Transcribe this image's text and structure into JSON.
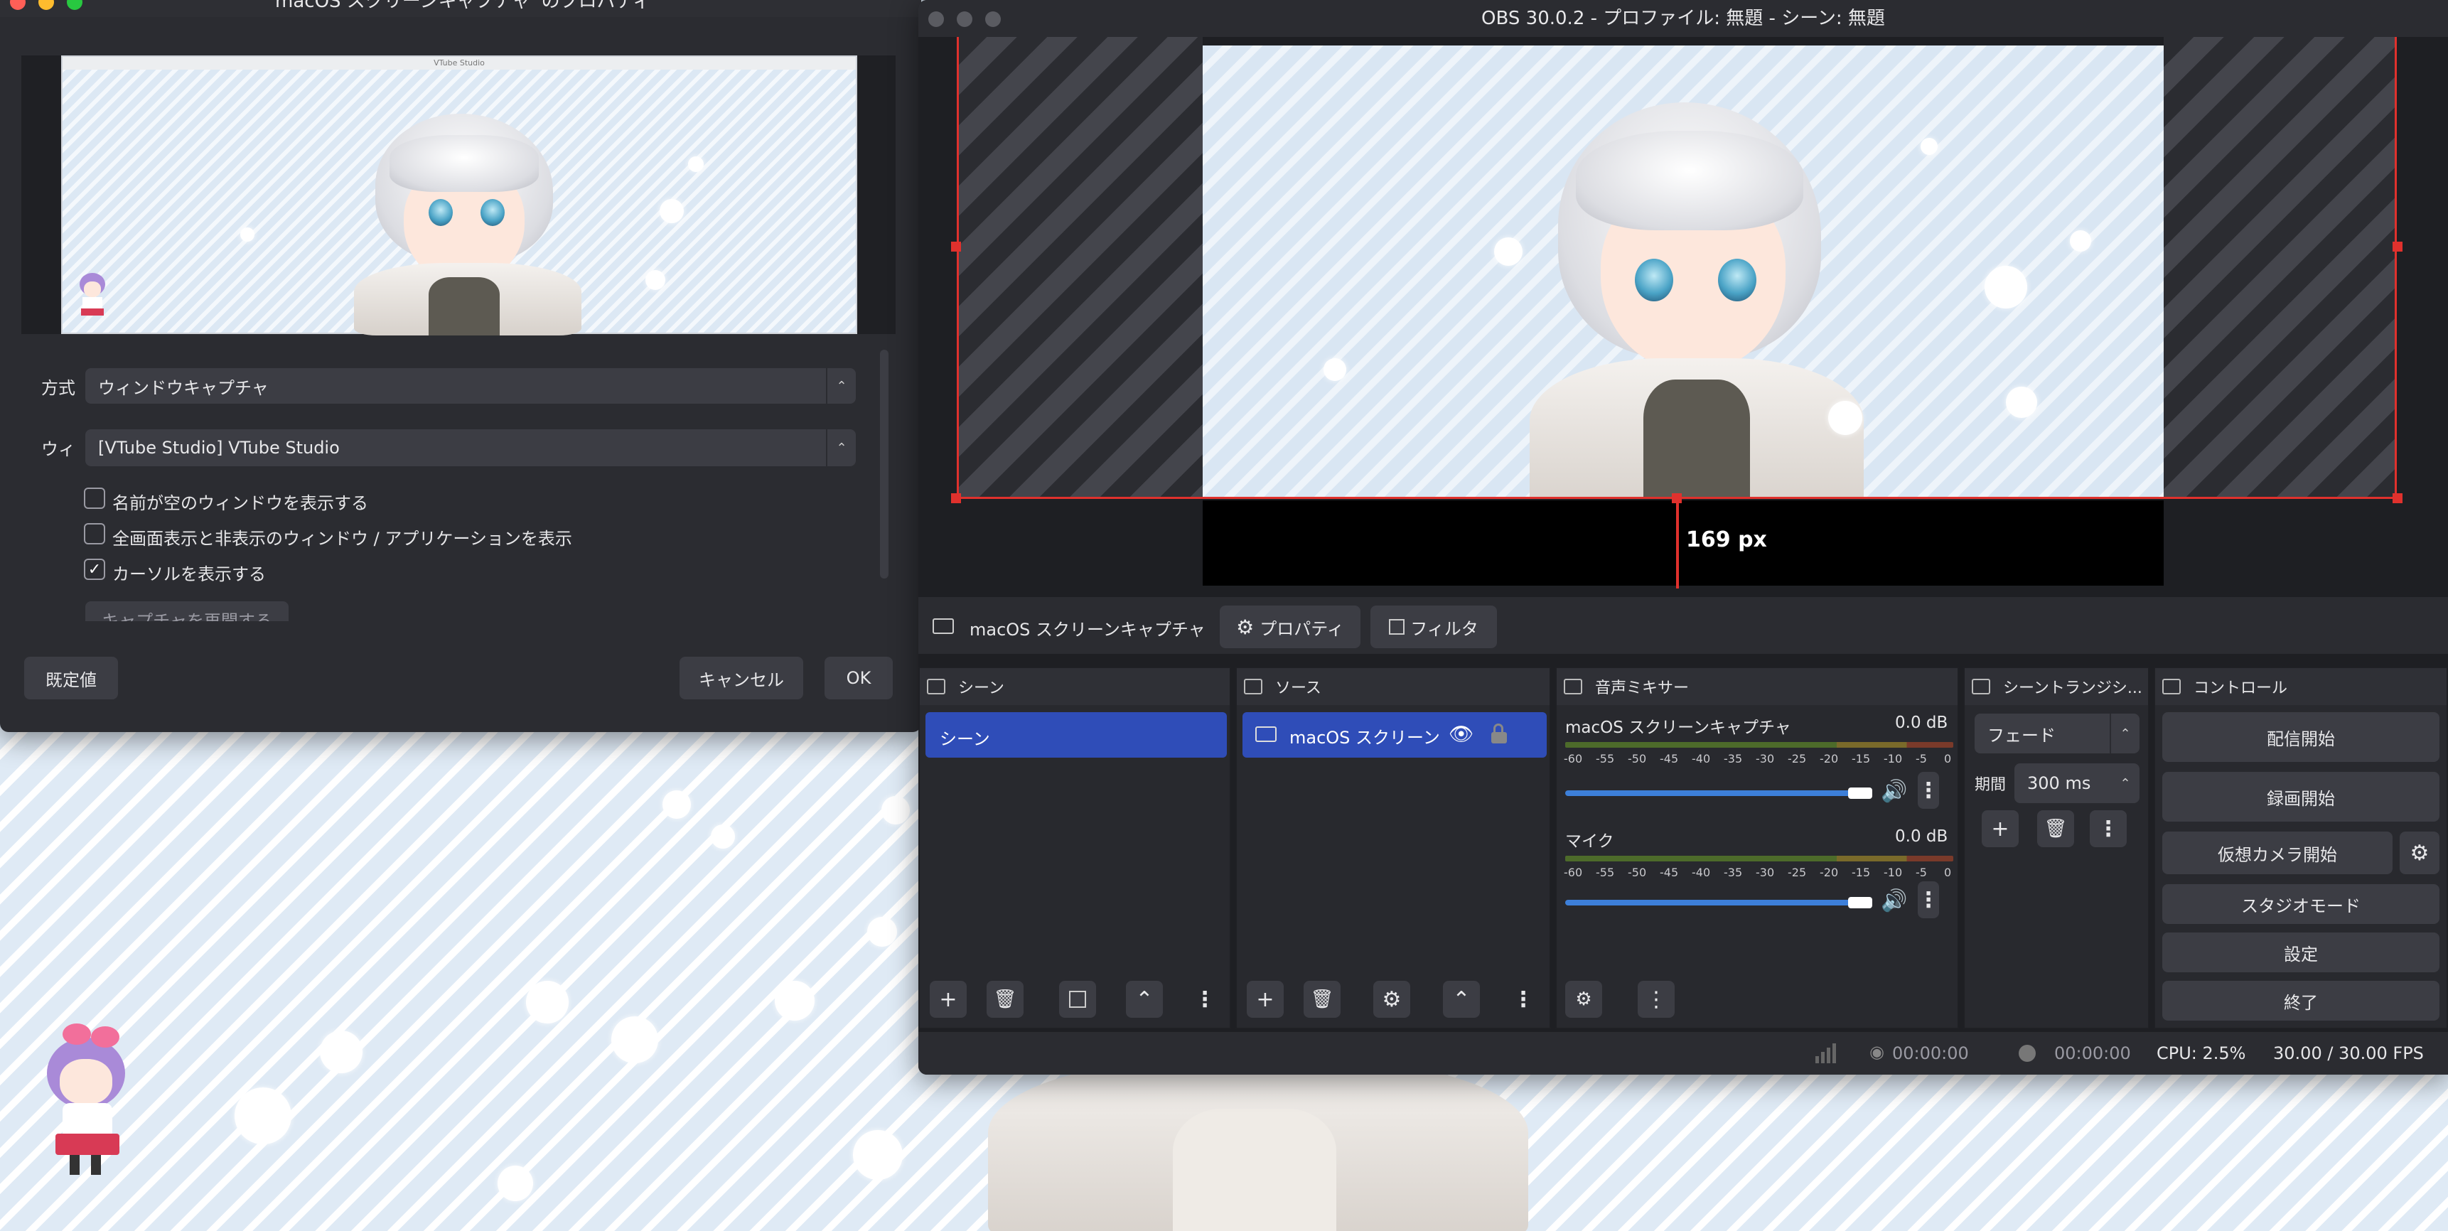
{
  "props_dialog": {
    "title": "'macOS スクリーンキャプチャ' のプロパティ",
    "preview_window_title": "VTube Studio",
    "method_label": "方式",
    "method_value": "ウィンドウキャプチャ",
    "window_label": "ウィ",
    "window_value": "[VTube Studio] VTube Studio",
    "checkbox_empty_names": "名前が空のウィンドウを表示する",
    "checkbox_fullscreen": "全画面表示と非表示のウィンドウ / アプリケーションを表示",
    "checkbox_cursor": "カーソルを表示する",
    "cursor_checked": true,
    "empty_names_checked": false,
    "fullscreen_checked": false,
    "restart_capture_button": "キャプチャを再開する",
    "defaults_button": "既定値",
    "cancel_button": "キャンセル",
    "ok_button": "OK"
  },
  "obs": {
    "title": "OBS 30.0.2 - プロファイル: 無題 - シーン: 無題",
    "crop_label": "169 px",
    "source_toolbar": {
      "source_name": "macOS スクリーンキャプチャ",
      "properties_button": "プロパティ",
      "filters_button": "フィルタ"
    },
    "scenes_dock": {
      "title": "シーン",
      "items": [
        "シーン"
      ],
      "selected": 0
    },
    "sources_dock": {
      "title": "ソース",
      "items": [
        "macOS スクリーン"
      ]
    },
    "mixer_dock": {
      "title": "音声ミキサー",
      "channels": [
        {
          "name": "macOS スクリーンキャプチャ",
          "db": "0.0 dB",
          "volume": 1.0
        },
        {
          "name": "マイク",
          "db": "0.0 dB",
          "volume": 1.0
        }
      ],
      "scale": [
        "-60",
        "-55",
        "-50",
        "-45",
        "-40",
        "-35",
        "-30",
        "-25",
        "-20",
        "-15",
        "-10",
        "-5",
        "0"
      ]
    },
    "transitions_dock": {
      "title": "シーントランジシ...",
      "transition": "フェード",
      "duration_label": "期間",
      "duration": "300 ms"
    },
    "controls_dock": {
      "title": "コントロール",
      "start_streaming": "配信開始",
      "start_recording": "録画開始",
      "start_virtual_cam": "仮想カメラ開始",
      "studio_mode": "スタジオモード",
      "settings": "設定",
      "exit": "終了"
    },
    "status_bar": {
      "stream_time": "00:00:00",
      "record_time": "00:00:00",
      "cpu": "CPU: 2.5%",
      "fps": "30.00 / 30.00 FPS"
    }
  },
  "colors": {
    "accent": "#2f4db8",
    "window_bg": "#2b2c31",
    "button_bg": "#3c3d44",
    "selection_red": "#e0312d",
    "traffic_close": "#ff5f57",
    "traffic_min": "#febc2e",
    "traffic_max": "#28c840"
  }
}
